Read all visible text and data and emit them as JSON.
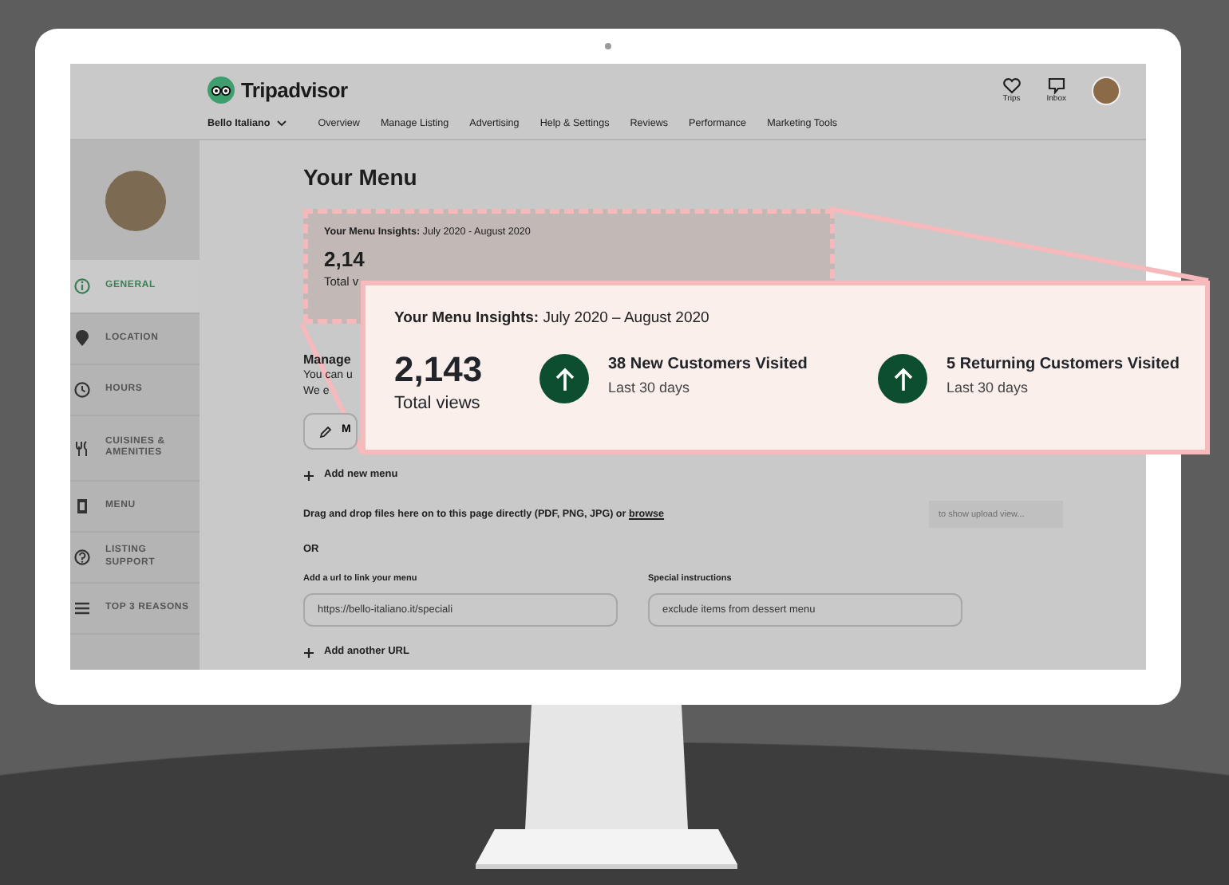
{
  "screen": {
    "header": {
      "logo": "Tripadvisor",
      "actions": [
        {
          "label": "Trips",
          "kind": "heart"
        },
        {
          "label": "Inbox",
          "kind": "message"
        }
      ]
    },
    "nav": {
      "business": "Bello Italiano",
      "items": [
        "Overview",
        "Manage Listing",
        "Advertising",
        "Help & Settings",
        "Reviews",
        "Performance",
        "Marketing Tools"
      ]
    },
    "sidebar": {
      "items": [
        {
          "label": "GENERAL",
          "kind": "info",
          "selected": true
        },
        {
          "label": "LOCATION",
          "kind": "pin",
          "selected": false
        },
        {
          "label": "HOURS",
          "kind": "clock",
          "selected": false
        },
        {
          "label": "CUISINES & AMENITIES",
          "kind": "utensils",
          "selected": false
        },
        {
          "label": "MENU",
          "kind": "document",
          "selected": false
        },
        {
          "label": "LISTING SUPPORT",
          "kind": "help",
          "selected": false
        },
        {
          "label": "TOP 3 REASONS",
          "kind": "list",
          "selected": false
        }
      ]
    },
    "main": {
      "title": "Your Menu",
      "insights": {
        "heading": "**Your Menu Insights:** July 2020 - August 2020",
        "total": "2,14",
        "total_label": "Total v"
      },
      "manage": {
        "title": "Manage",
        "lines": [
          "You can u",
          "We e"
        ],
        "button": "M"
      },
      "add_menu": "Add new menu",
      "drop": {
        "text": "Drag and drop files here on to this page directly (PDF, PNG, JPG) or",
        "link": "browse",
        "upload_placeholder": "to show upload view..."
      },
      "or": "OR",
      "fields": [
        {
          "label": "Add a url to link your menu",
          "value": "https://bello-italiano.it/speciali"
        },
        {
          "label": "Special instructions",
          "value": "exclude items from dessert menu"
        }
      ],
      "add_url": "Add another URL"
    }
  },
  "callout": {
    "heading": "**Your Menu Insights:** July 2020 – August 2020",
    "total": "2,143",
    "total_label": "Total views",
    "stats": [
      {
        "title": "38 New Customers Visited",
        "subtitle": "Last 30 days"
      },
      {
        "title": "5 Returning Customers Visited",
        "subtitle": "Last 30 days"
      }
    ]
  }
}
